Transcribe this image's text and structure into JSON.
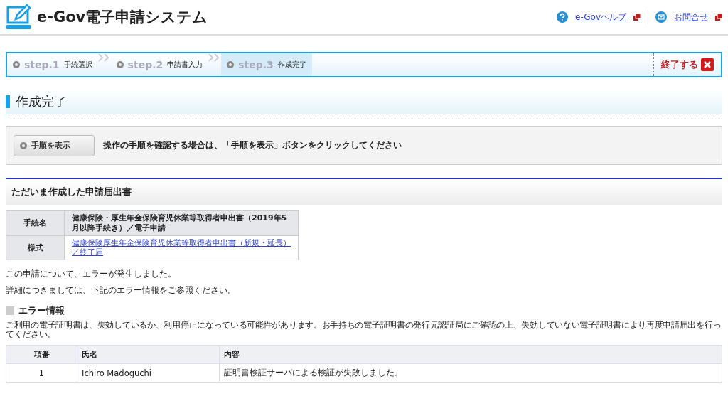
{
  "header": {
    "logo_text": "e-Gov電子申請システム",
    "links": [
      {
        "kind": "help",
        "label": "e-Govヘルプ"
      },
      {
        "kind": "contact",
        "label": "お問合せ"
      }
    ]
  },
  "steps": [
    {
      "step": "step.1",
      "label": "手続選択",
      "selected": false
    },
    {
      "step": "step.2",
      "label": "申請書入力",
      "selected": false
    },
    {
      "step": "step.3",
      "label": "作成完了",
      "selected": true
    }
  ],
  "exit_button": "終了する",
  "page_title": "作成完了",
  "guide": {
    "button": "手順を表示",
    "text": "操作の手順を確認する場合は、「手順を表示」ボタンをクリックしてください"
  },
  "section_title": "ただいま作成した申請届出書",
  "info_table": [
    {
      "label": "手続名",
      "value": "健康保険・厚生年金保険育児休業等取得者申出書（2019年5月以降手続き）／電子申請",
      "kind": "text"
    },
    {
      "label": "様式",
      "value": "健康保険厚生年金保険育児休業等取得者申出書（新規・延長）／終了届",
      "kind": "link"
    }
  ],
  "messages": [
    "この申請について、エラーが発生しました。",
    "詳細につきましては、下記のエラー情報をご参照ください。"
  ],
  "error_title": "エラー情報",
  "error_text": "ご利用の電子証明書は、失効しているか、利用停止になっている可能性があります。お手持ちの電子証明書の発行元認証局にご確認の上、失効していない電子証明書により再度申請届出を行ってください。",
  "error_table": {
    "columns": [
      "項番",
      "氏名",
      "内容"
    ],
    "rows": [
      [
        "1",
        "Ichiro Madoguchi",
        "証明書検証サーバによる検証が失敗しました。"
      ]
    ]
  }
}
